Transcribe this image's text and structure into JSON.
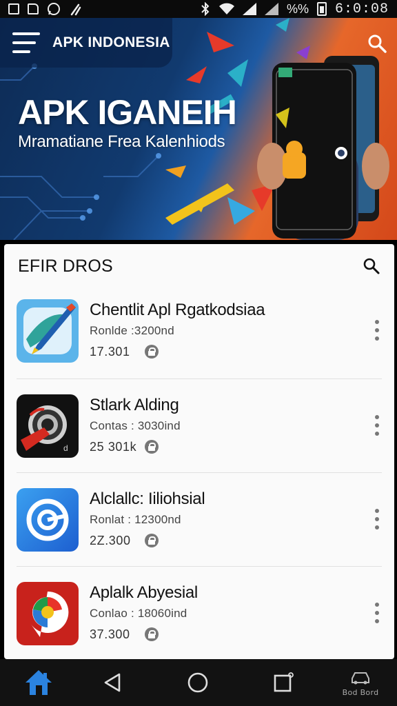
{
  "status_bar": {
    "time": "6:0:08",
    "battery_text": "%%",
    "left_icons": [
      "gallery-icon",
      "sd-card-icon",
      "whatsapp-icon",
      "tools-icon"
    ],
    "right_icons": [
      "bluetooth-icon",
      "wifi-icon",
      "signal-icon",
      "signal-icon",
      "battery-icon"
    ]
  },
  "header": {
    "app_title": "APK INDONESIA"
  },
  "hero": {
    "title": "APK IGANEIH",
    "subtitle": "Mramatiane Frea Kalenhiods"
  },
  "section": {
    "title": "EFIR DROS"
  },
  "apps": [
    {
      "name": "Chentlit Apl Rgatkodsiaa",
      "meta": "Ronlde :3200nd",
      "size": "17.301",
      "icon": "pen-app-icon",
      "bg": "#5bb4ea"
    },
    {
      "name": "Stlark Alding",
      "meta": "Contas : 3030ind",
      "size": "25 301k",
      "icon": "target-app-icon",
      "bg": "#111111"
    },
    {
      "name": "Alclallc: Iiliohsial",
      "meta": "Ronlat : 12300nd",
      "size": "2Z.300",
      "icon": "swirl-app-icon",
      "bg": "#2a7de0"
    },
    {
      "name": "Aplalk Abyesial",
      "meta": "Conlao : 18060ind",
      "size": "37.300",
      "icon": "chrome-app-icon",
      "bg": "#c8221c"
    }
  ],
  "nav": {
    "home_icon": "home-icon",
    "back_icon": "back-icon",
    "home_circle_icon": "home-circle-icon",
    "recents_icon": "recents-icon",
    "extra_label": "Bod Bord"
  },
  "colors": {
    "accent": "#1976d2",
    "hero_dark": "#0d2b55",
    "hero_orange": "#e6672a",
    "card_bg": "#fafafa"
  }
}
